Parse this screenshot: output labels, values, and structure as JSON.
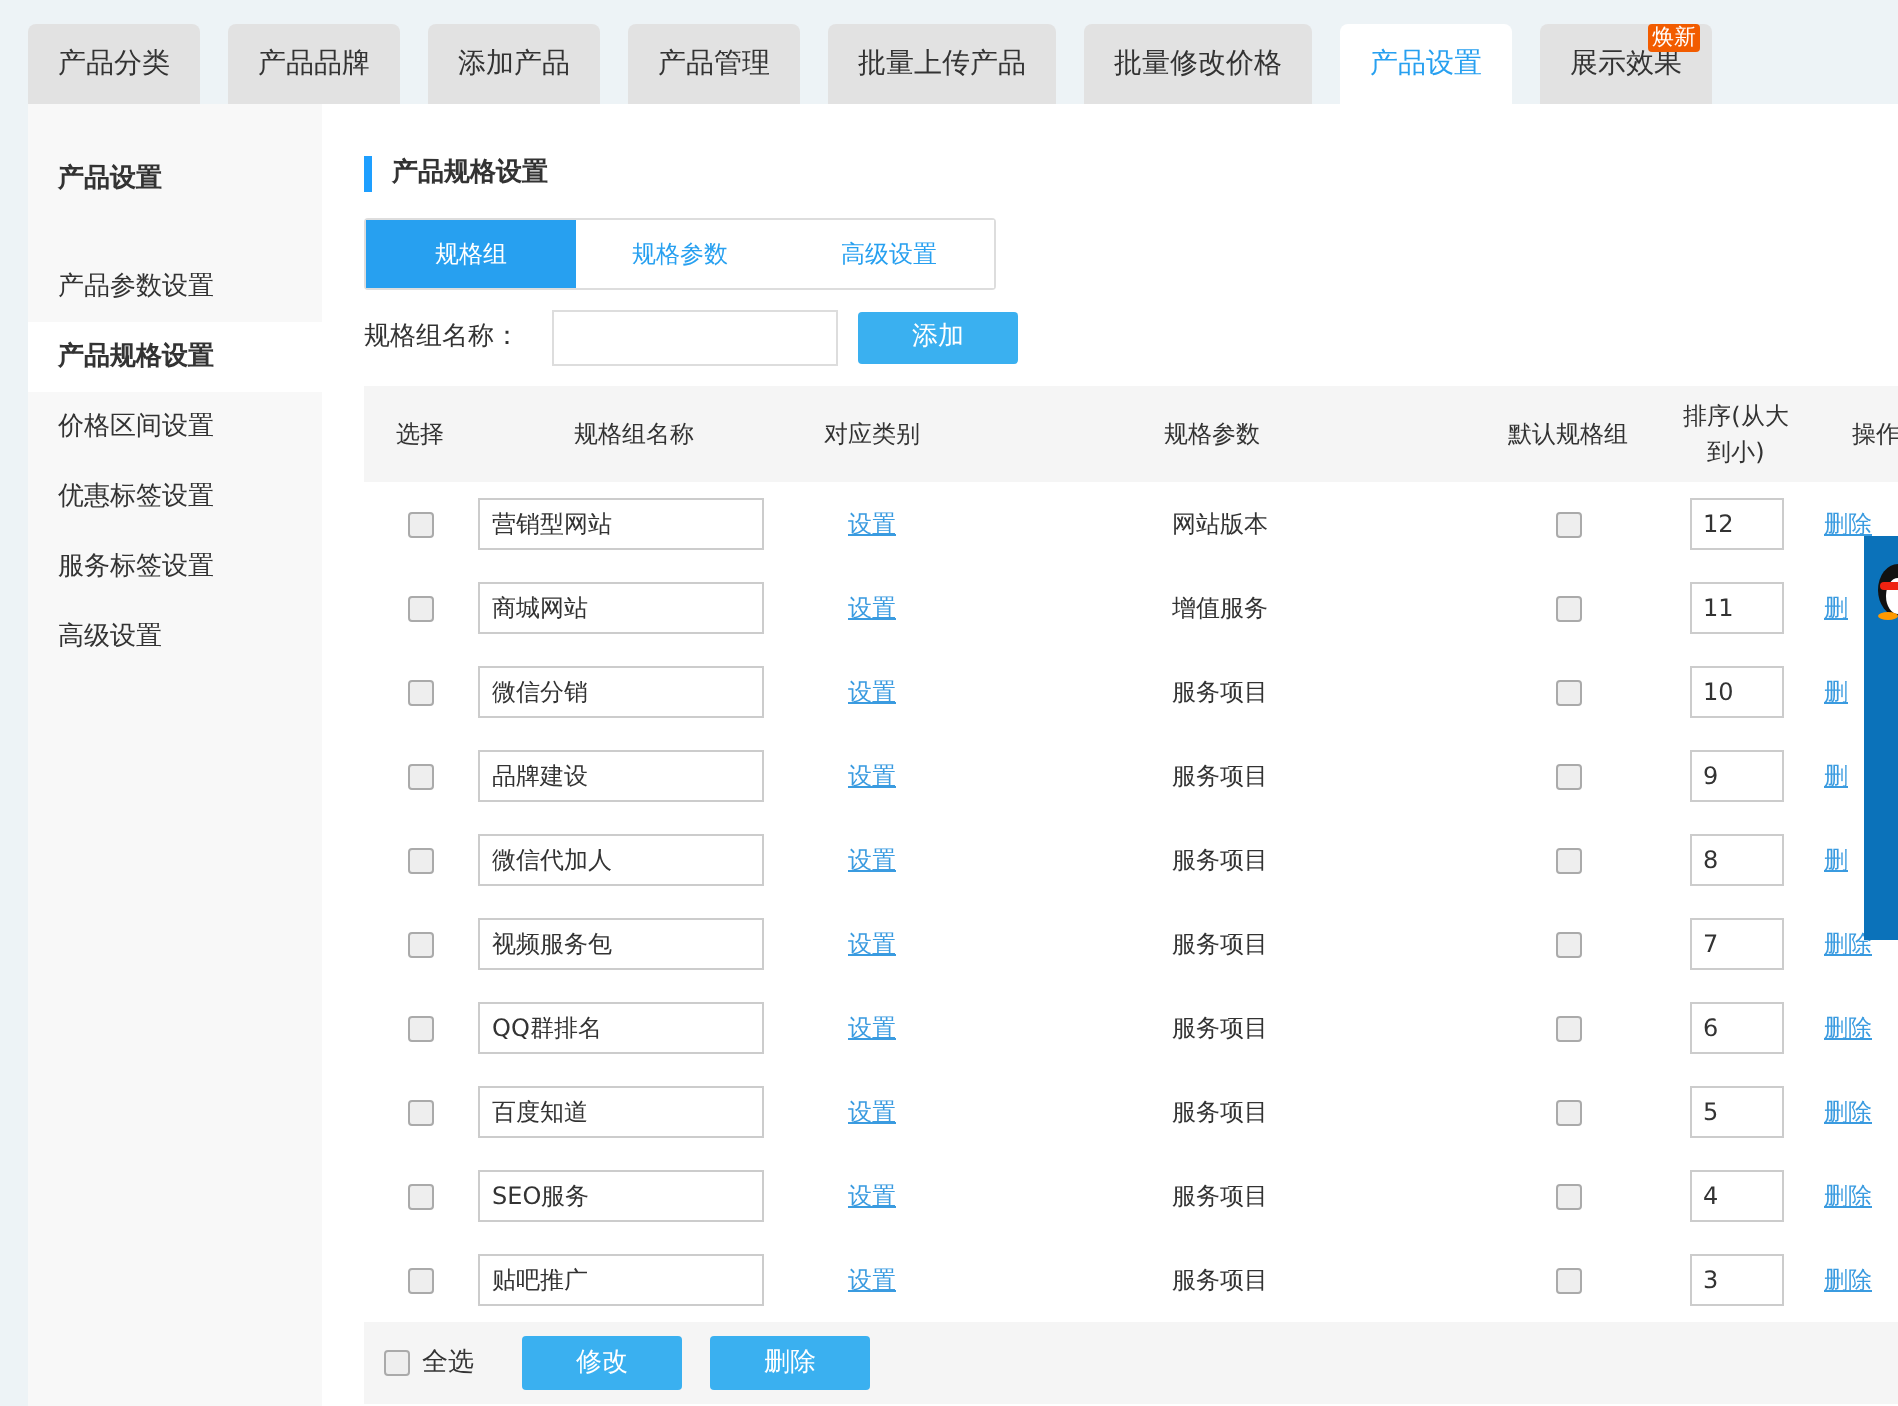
{
  "top_tabs": [
    {
      "label": "产品分类",
      "selected": false
    },
    {
      "label": "产品品牌",
      "selected": false
    },
    {
      "label": "添加产品",
      "selected": false
    },
    {
      "label": "产品管理",
      "selected": false
    },
    {
      "label": "批量上传产品",
      "selected": false
    },
    {
      "label": "批量修改价格",
      "selected": false
    },
    {
      "label": "产品设置",
      "selected": true
    },
    {
      "label": "展示效果",
      "selected": false,
      "badge": "焕新"
    }
  ],
  "sidebar": {
    "title": "产品设置",
    "items": [
      {
        "label": "产品参数设置",
        "selected": false
      },
      {
        "label": "产品规格设置",
        "selected": true
      },
      {
        "label": "价格区间设置",
        "selected": false
      },
      {
        "label": "优惠标签设置",
        "selected": false
      },
      {
        "label": "服务标签设置",
        "selected": false
      },
      {
        "label": "高级设置",
        "selected": false
      }
    ]
  },
  "section_title": "产品规格设置",
  "sub_tabs": [
    {
      "label": "规格组",
      "selected": true
    },
    {
      "label": "规格参数",
      "selected": false
    },
    {
      "label": "高级设置",
      "selected": false
    }
  ],
  "form": {
    "label": "规格组名称：",
    "button": "添加"
  },
  "table": {
    "columns": [
      "选择",
      "规格组名称",
      "对应类别",
      "规格参数",
      "默认规格组",
      "排序(从大到小)",
      "操作"
    ],
    "rows": [
      {
        "checked": false,
        "name": "营销型网站",
        "category_link": "设置",
        "params": "网站版本",
        "default": false,
        "order": "12",
        "action": "删除"
      },
      {
        "checked": false,
        "name": "商城网站",
        "category_link": "设置",
        "params": "增值服务",
        "default": false,
        "order": "11",
        "action": "删"
      },
      {
        "checked": false,
        "name": "微信分销",
        "category_link": "设置",
        "params": "服务项目",
        "default": false,
        "order": "10",
        "action": "删"
      },
      {
        "checked": false,
        "name": "品牌建设",
        "category_link": "设置",
        "params": "服务项目",
        "default": false,
        "order": "9",
        "action": "删"
      },
      {
        "checked": false,
        "name": "微信代加人",
        "category_link": "设置",
        "params": "服务项目",
        "default": false,
        "order": "8",
        "action": "删"
      },
      {
        "checked": false,
        "name": "视频服务包",
        "category_link": "设置",
        "params": "服务项目",
        "default": false,
        "order": "7",
        "action": "删除"
      },
      {
        "checked": false,
        "name": "QQ群排名",
        "category_link": "设置",
        "params": "服务项目",
        "default": false,
        "order": "6",
        "action": "删除"
      },
      {
        "checked": false,
        "name": "百度知道",
        "category_link": "设置",
        "params": "服务项目",
        "default": false,
        "order": "5",
        "action": "删除"
      },
      {
        "checked": false,
        "name": "SEO服务",
        "category_link": "设置",
        "params": "服务项目",
        "default": false,
        "order": "4",
        "action": "删除"
      },
      {
        "checked": false,
        "name": "贴吧推广",
        "category_link": "设置",
        "params": "服务项目",
        "default": false,
        "order": "3",
        "action": "删除"
      }
    ]
  },
  "footer": {
    "select_all": {
      "label": "全选",
      "checked": false
    },
    "buttons": [
      "修改",
      "删除"
    ]
  },
  "float_panel": {
    "kind": "qq"
  }
}
